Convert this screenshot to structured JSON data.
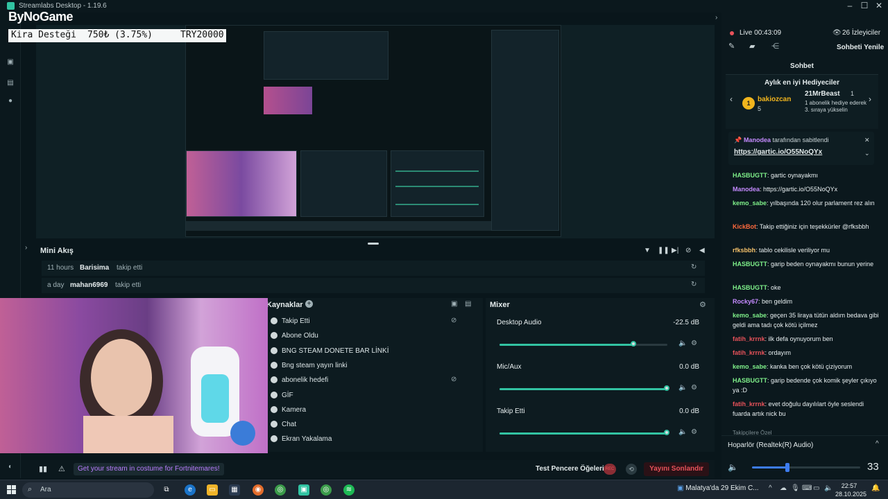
{
  "window": {
    "title": "Streamlabs Desktop - 1.19.6",
    "brand_logo": "ByNoGame"
  },
  "overlay": {
    "donation_label": "Kira Desteği",
    "donation_amount": "750₺ (3.75%)",
    "donation_goal": "TRY20000"
  },
  "mini_feed": {
    "title": "Mini Akış",
    "rows": [
      {
        "time": "11 hours",
        "user": "Barisima",
        "action": "takip etti"
      },
      {
        "time": "a day",
        "user": "mahan6969",
        "action": "takip etti"
      }
    ]
  },
  "sources": {
    "title": "Kaynaklar",
    "items": [
      {
        "label": "Takip Etti",
        "hidden": true
      },
      {
        "label": "Abone Oldu",
        "hidden": false
      },
      {
        "label": "BNG STEAM DONETE BAR LİNKİ",
        "hidden": false
      },
      {
        "label": "Bng steam yayın linki",
        "hidden": false
      },
      {
        "label": "abonelik hedefi",
        "hidden": true
      },
      {
        "label": "GİF",
        "hidden": false
      },
      {
        "label": "Kamera",
        "hidden": false
      },
      {
        "label": "Chat",
        "hidden": false
      },
      {
        "label": "Ekran Yakalama",
        "hidden": false
      }
    ]
  },
  "mixer": {
    "title": "Mixer",
    "channels": [
      {
        "name": "Desktop Audio",
        "level": "-22.5 dB",
        "volume": 0.8
      },
      {
        "name": "Mic/Aux",
        "level": "0.0 dB",
        "volume": 1.0
      },
      {
        "name": "Takip Etti",
        "level": "0.0 dB",
        "volume": 1.0
      }
    ]
  },
  "bottombar": {
    "promo": "Get your stream in costume for Fortnitemares!",
    "test_widgets": "Test Pencere Öğeleri",
    "rec": "REC",
    "end_stream": "Yayını Sonlandır"
  },
  "chat": {
    "live_label": "Live",
    "live_time": "00:43:09",
    "viewers_label": "26 İzleyiciler",
    "refresh": "Sohbeti Yenile",
    "tab": "Sohbet",
    "gifters_title": "Aylık en iyi Hediyeciler",
    "top_gifter": "bakiozcan",
    "top_gifter_count": "5",
    "second_gifter": "21MrBeast",
    "second_gifter_count": "1",
    "second_gifter_note": "1 abonelik hediye ederek 3. sıraya yükselin",
    "pinned_by": "Manodea",
    "pinned_suffix": "tarafından sabitlendi",
    "pinned_link": "https://gartic.io/O55NoQYx",
    "messages": [
      {
        "user": "HASBUGTT",
        "text": "gartic oynayakmı",
        "color": "#7ff08a"
      },
      {
        "user": "Manodea",
        "text": "https://gartic.io/O55NoQYx",
        "color": "#c58bff"
      },
      {
        "user": "kemo_sabe",
        "text": "yılbaşında 120 olur parlament rez alın",
        "color": "#7ff08a"
      },
      {
        "user": "KickBot",
        "text": "Takip ettiğiniz için teşekkürler @rfksbbh",
        "color": "#ff6a3d"
      },
      {
        "user": "rfksbbh",
        "text": "tablo cekilisle veriliyor mu",
        "color": "#f6c26b"
      },
      {
        "user": "HASBUGTT",
        "text": "garip beden oynayakmı bunun yerine",
        "color": "#7ff08a"
      },
      {
        "user": "HASBUGTT",
        "text": "oke",
        "color": "#7ff08a"
      },
      {
        "user": "Rocky67",
        "text": "ben geldim",
        "color": "#c58bff"
      },
      {
        "user": "kemo_sabe",
        "text": "geçen 35 liraya tütün aldım bedava gibi geldi ama tadı çok kötü içilmez",
        "color": "#7ff08a"
      },
      {
        "user": "fatih_krrnk",
        "text": "ilk defa oynuyorum ben",
        "color": "#e8525a"
      },
      {
        "user": "fatih_krrnk",
        "text": "ordayım",
        "color": "#e8525a"
      },
      {
        "user": "kemo_sabe",
        "text": "kanka ben çok kötü çiziyorum",
        "color": "#7ff08a"
      },
      {
        "user": "HASBUGTT",
        "text": "garip bedende çok komik şeyler çıkıyo ya :D",
        "color": "#7ff08a"
      },
      {
        "user": "fatih_krrnk",
        "text": "evet doğulu dayılılart öyle seslendi fuarda artık nick bu",
        "color": "#e8525a"
      }
    ],
    "followers_only": "Takipçilere Özel",
    "audio_device": "Hoparlör (Realtek(R) Audio)",
    "volume": "33"
  },
  "taskbar": {
    "search": "Ara",
    "weather": "Malatya'da 29 Ekim C...",
    "time": "22:57",
    "date": "28.10.2025"
  },
  "colors": {
    "accent": "#32c3a2",
    "danger": "#e8525a",
    "bg": "#09161b"
  }
}
